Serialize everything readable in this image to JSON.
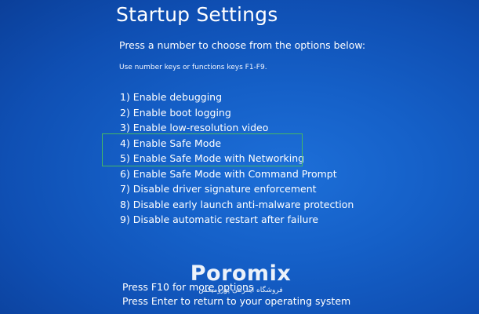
{
  "screen": {
    "title": "Startup Settings",
    "prompt": "Press a number to choose from the options below:",
    "hint": "Use number keys or functions keys F1-F9."
  },
  "options": [
    "1) Enable debugging",
    "2) Enable boot logging",
    "3) Enable low-resolution video",
    "4) Enable Safe Mode",
    "5) Enable Safe Mode with Networking",
    "6) Enable Safe Mode with Command Prompt",
    "7) Disable driver signature enforcement",
    "8) Disable early launch anti-malware protection",
    "9) Disable automatic restart after failure"
  ],
  "footer": {
    "line1": "Press F10 for more options",
    "line2": "Press Enter to return to your operating system"
  },
  "watermark": {
    "name": "Poromix",
    "subtitle": "فروشگاه اینترنتی پورومیکس"
  },
  "colors": {
    "background": "#1560c8",
    "text": "#ffffff",
    "highlight_border": "#45b865"
  }
}
